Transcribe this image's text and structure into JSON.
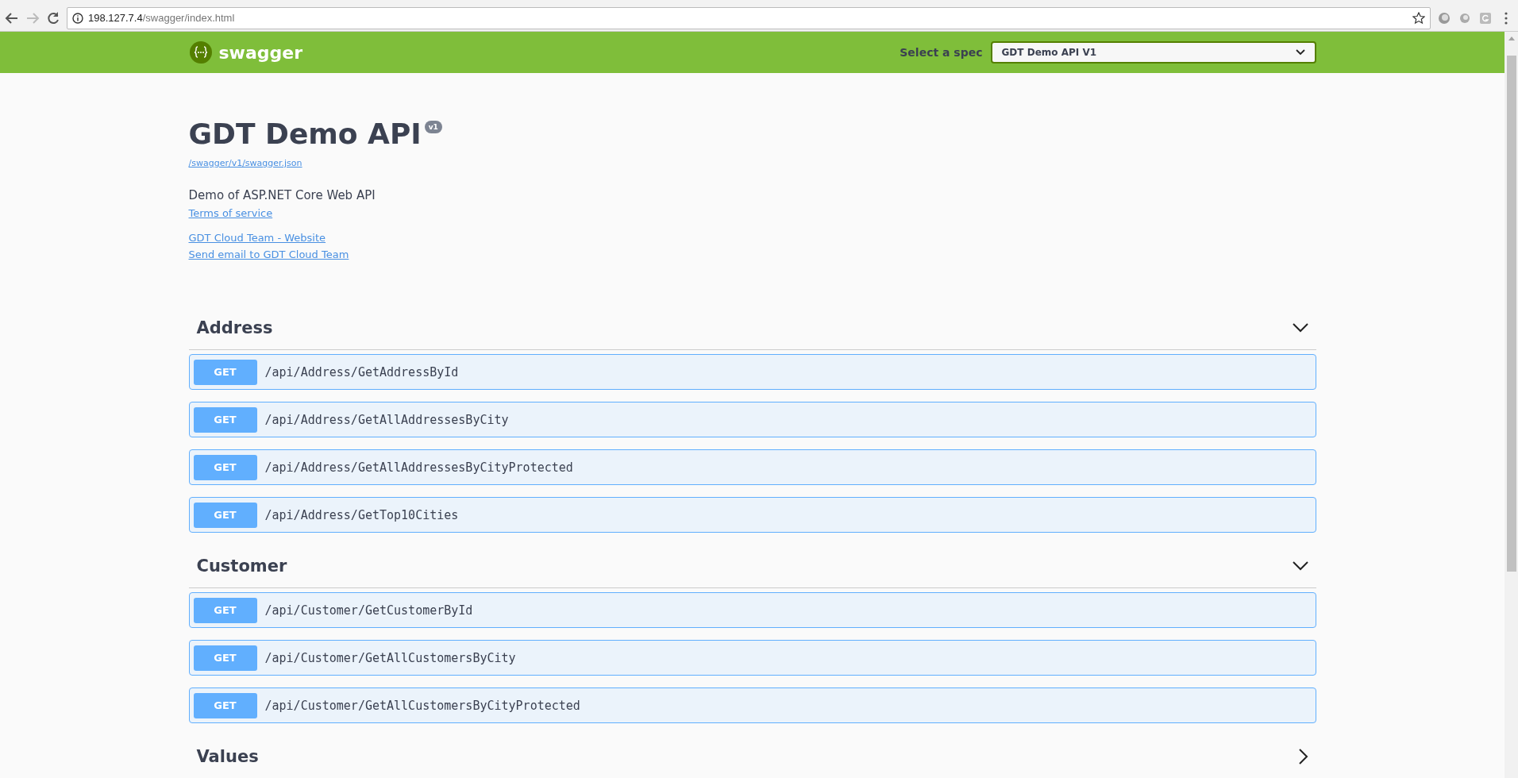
{
  "browser": {
    "url_host": "198.127.7.4",
    "url_path": "/swagger/index.html"
  },
  "topbar": {
    "brand": "swagger",
    "spec_label": "Select a spec",
    "spec_value": "GDT Demo API V1"
  },
  "info": {
    "title": "GDT Demo API",
    "version": "v1",
    "spec_link": "/swagger/v1/swagger.json",
    "description": "Demo of ASP.NET Core Web API",
    "links": [
      "Terms of service",
      "GDT Cloud Team - Website",
      "Send email to GDT Cloud Team"
    ]
  },
  "sections": [
    {
      "name": "Address",
      "expanded": true,
      "operations": [
        {
          "method": "GET",
          "path": "/api/Address/GetAddressById"
        },
        {
          "method": "GET",
          "path": "/api/Address/GetAllAddressesByCity"
        },
        {
          "method": "GET",
          "path": "/api/Address/GetAllAddressesByCityProtected"
        },
        {
          "method": "GET",
          "path": "/api/Address/GetTop10Cities"
        }
      ]
    },
    {
      "name": "Customer",
      "expanded": true,
      "operations": [
        {
          "method": "GET",
          "path": "/api/Customer/GetCustomerById"
        },
        {
          "method": "GET",
          "path": "/api/Customer/GetAllCustomersByCity"
        },
        {
          "method": "GET",
          "path": "/api/Customer/GetAllCustomersByCityProtected"
        }
      ]
    },
    {
      "name": "Values",
      "expanded": false
    }
  ]
}
